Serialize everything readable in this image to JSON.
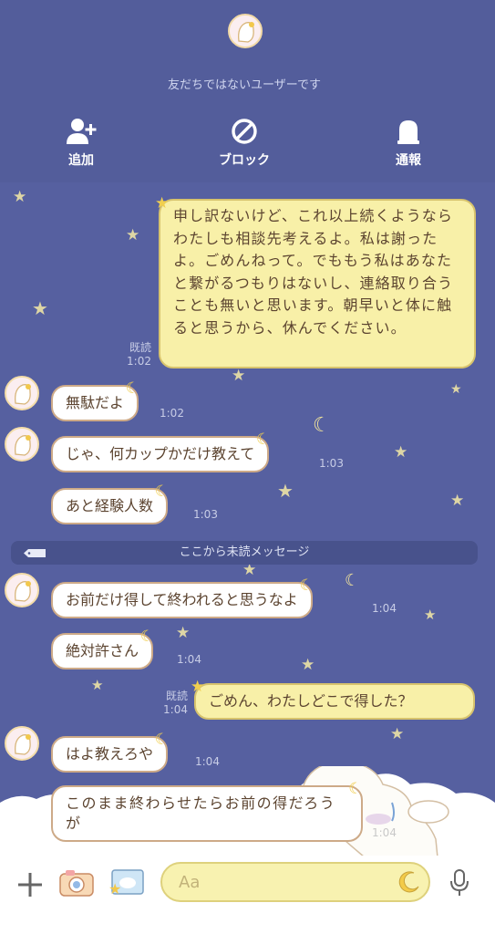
{
  "header": {
    "notice": "友だちではないユーザーです",
    "actions": [
      {
        "label": "追加",
        "icon": "add-friend-icon"
      },
      {
        "label": "ブロック",
        "icon": "block-icon"
      },
      {
        "label": "通報",
        "icon": "report-icon"
      }
    ]
  },
  "messages": [
    {
      "from": "me",
      "text": "申し訳ないけど、これ以上続くようならわたしも相談先考えるよ。私は謝ったよ。ごめんねって。でももう私はあなたと繋がるつもりはないし、連絡取り合うことも無いと思います。朝早いと体に触ると思うから、休んでください。",
      "read": "既読",
      "time": "1:02"
    },
    {
      "from": "other",
      "text": "無駄だよ",
      "time": "1:02"
    },
    {
      "from": "other",
      "text": "じゃ、何カップかだけ教えて",
      "time": "1:03"
    },
    {
      "from": "other",
      "text": "あと経験人数",
      "time": "1:03"
    },
    {
      "from": "other",
      "text": "お前だけ得して終われると思うなよ",
      "time": "1:04"
    },
    {
      "from": "other",
      "text": "絶対許さん",
      "time": "1:04"
    },
    {
      "from": "me",
      "text": "ごめん、わたしどこで得した？",
      "read": "既読",
      "time": "1:04"
    },
    {
      "from": "other",
      "text": "はよ教えろや",
      "time": "1:04"
    },
    {
      "from": "other",
      "text": "このまま終わらせたらお前の得だろうが",
      "time": "1:04"
    }
  ],
  "unread_divider": "ここから未読メッセージ",
  "composer": {
    "placeholder": "Aa",
    "icons": [
      "plus-icon",
      "camera-icon",
      "photo-icon",
      "moon-icon",
      "microphone-icon"
    ]
  },
  "colors": {
    "background": "#5660a0",
    "incoming_bubble": "#ffffff",
    "outgoing_bubble": "#f8f0a8",
    "bubble_text": "#5c4430"
  }
}
